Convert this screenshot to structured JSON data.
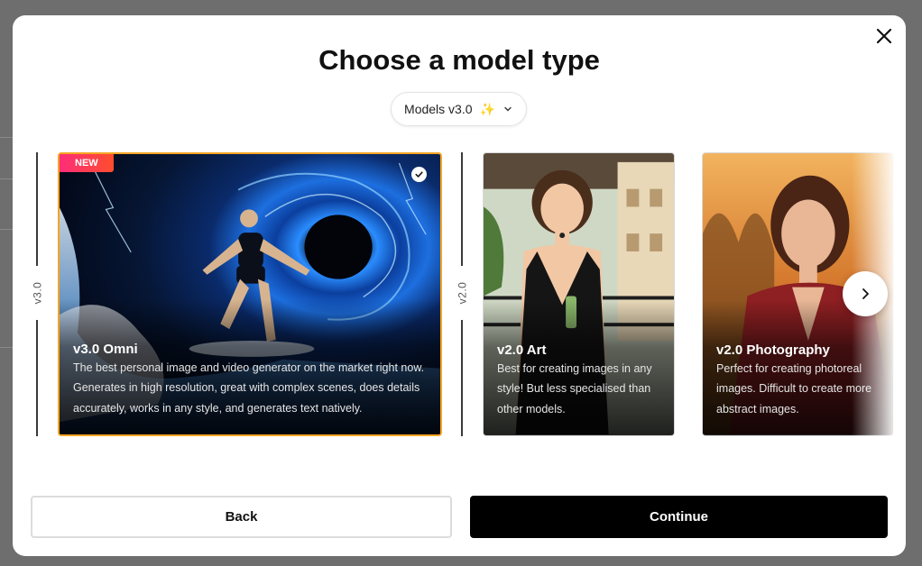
{
  "modal": {
    "title": "Choose a model type",
    "version_select": {
      "label": "Models v3.0",
      "sparkle": "✨"
    },
    "groups": [
      {
        "label": "v3.0"
      },
      {
        "label": "v2.0"
      }
    ],
    "cards": [
      {
        "name": "v3.0 Omni",
        "description": "The best personal image and video generator on the market right now. Generates in high resolution, great with complex scenes, does details accurately, works in any style, and generates text natively.",
        "badge": "NEW",
        "selected": true
      },
      {
        "name": "v2.0 Art",
        "description": "Best for creating images in any style! But less specialised than other models.",
        "selected": false
      },
      {
        "name": "v2.0 Photography",
        "description": "Perfect for creating photoreal images. Difficult to create more abstract images.",
        "selected": false
      }
    ],
    "buttons": {
      "back": "Back",
      "continue": "Continue"
    },
    "colors": {
      "selected_border": "#f5a524",
      "badge": "#ff2d7a",
      "primary": "#000000"
    },
    "icons": {
      "close": "close-icon",
      "next": "chevron-right-icon",
      "select": "chevron-down-icon",
      "check": "check-icon"
    }
  }
}
